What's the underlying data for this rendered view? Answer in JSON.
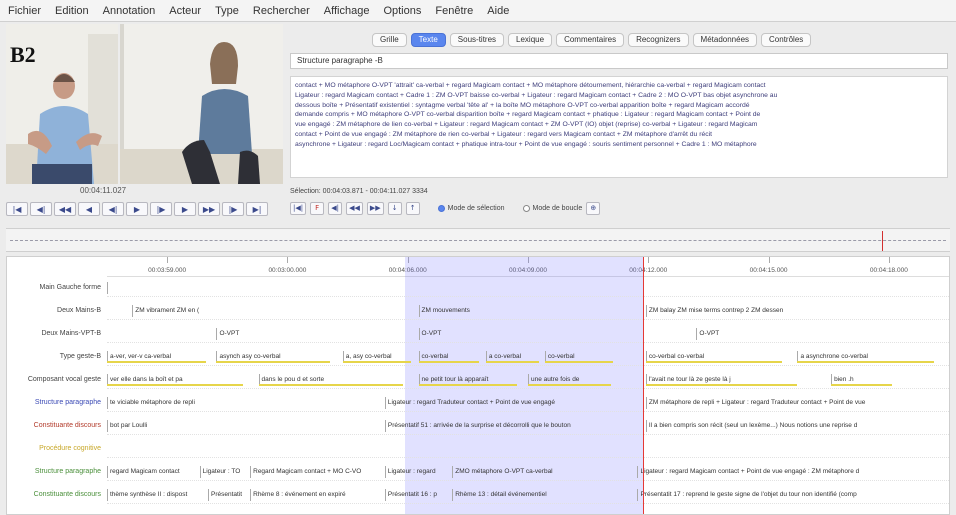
{
  "menu": [
    "Fichier",
    "Edition",
    "Annotation",
    "Acteur",
    "Type",
    "Rechercher",
    "Affichage",
    "Options",
    "Fenêtre",
    "Aide"
  ],
  "video": {
    "watermark": "B2",
    "timecode": "00:04:11.027"
  },
  "media_buttons": [
    "|◀",
    "◀|",
    "◀◀",
    "◀",
    "◀|",
    "▶",
    "|▶",
    "▶",
    "▶▶",
    "|▶",
    "▶|"
  ],
  "tabs": [
    {
      "label": "Grille",
      "active": false
    },
    {
      "label": "Texte",
      "active": true
    },
    {
      "label": "Sous-titres",
      "active": false
    },
    {
      "label": "Lexique",
      "active": false
    },
    {
      "label": "Commentaires",
      "active": false
    },
    {
      "label": "Recognizers",
      "active": false
    },
    {
      "label": "Métadonnées",
      "active": false
    },
    {
      "label": "Contrôles",
      "active": false
    }
  ],
  "tier_selector": "Structure paragraphe -B",
  "text_lines": [
    "contact + MO métaphore O-VPT 'attrait' ca-verbal + regard Magicam contact + MO métaphore détournement, hiérarchie ca-verbal + regard Magicam contact",
    "Ligateur : regard Magicam contact + Cadre 1 : ZM O-VPT baisse co-verbal + Ligateur : regard Magicam contact + Cadre 2 : MO O-VPT bas objet asynchrone au",
    "dessous boîte + Présentatif existentiel : syntagme verbal 'tête al' + la boîte   MO métaphore O-VPT co-verbal apparition boîte + regard Magicam accordé",
    "demande compris + MO métaphore O-VPT co-verbal disparition boîte + regard Magicam contact + phatique : Ligateur : regard Magicam contact + Point de",
    "vue engagé : ZM métaphore de lien co-verbal + Ligateur : regard Magicam contact + ZM O-VPT (IO) objet (reprise) co-verbal + Ligateur : regard Magicam",
    "contact + Point de vue engagé : ZM métaphore de rien co-verbal + Ligateur : regard vers Magicam contact + ZM métaphore d'arrêt du récit",
    "asynchrone + Ligateur : regard Loc/Magicam contact + phatique intra-tour + Point de vue engagé : souris sentiment personnel + Cadre 1 : MO métaphore"
  ],
  "selection": "Sélection: 00:04:03.871 - 00:04:11.027  3334",
  "ctrl_buttons": [
    "|◀|",
    "F",
    "◀|",
    "◀◀",
    "▶▶",
    "↓",
    "↑"
  ],
  "modes": [
    {
      "label": "Mode de sélection",
      "on": true
    },
    {
      "label": "Mode de boucle",
      "on": false
    }
  ],
  "mode_extra": "⊕",
  "ruler_ticks": [
    "00:03:59.000",
    "00:03:00.000",
    "00:04:06.000",
    "00:04:09.000",
    "00:04:12.000",
    "00:04:15.000",
    "00:04:18.000"
  ],
  "tiers": [
    {
      "name": "Main Gauche forme",
      "color": "#444444",
      "annotations": [
        {
          "t": "",
          "s": 0.0,
          "w": 0.04
        }
      ]
    },
    {
      "name": "Deux Mains-B",
      "color": "#444444",
      "annotations": [
        {
          "t": "ZM vibrament  ZM en (",
          "s": 0.03,
          "w": 0.17
        },
        {
          "t": "ZM mouvements",
          "s": 0.37,
          "w": 0.1
        },
        {
          "t": "ZM balay   ZM mise terms contrep 2   ZM dessen",
          "s": 0.64,
          "w": 0.3
        }
      ]
    },
    {
      "name": "Deux Mains-VPT-B",
      "color": "#444444",
      "annotations": [
        {
          "t": "O-VPT",
          "s": 0.13,
          "w": 0.08
        },
        {
          "t": "O-VPT",
          "s": 0.37,
          "w": 0.08
        },
        {
          "t": "O-VPT",
          "s": 0.7,
          "w": 0.08
        }
      ]
    },
    {
      "name": "Type geste-B",
      "color": "#444444",
      "annotations": [
        {
          "t": "a-ver, ver-v  ca-verbal",
          "s": 0.0,
          "w": 0.13
        },
        {
          "t": "asynch  asy  co-verbal",
          "s": 0.13,
          "w": 0.15
        },
        {
          "t": "a, asy  co-verbal",
          "s": 0.28,
          "w": 0.09
        },
        {
          "t": "co-verbal",
          "s": 0.37,
          "w": 0.08
        },
        {
          "t": "a   co-verbal",
          "s": 0.45,
          "w": 0.07
        },
        {
          "t": "co-verbal",
          "s": 0.52,
          "w": 0.09
        },
        {
          "t": "co-verbal  co-verbal",
          "s": 0.64,
          "w": 0.18
        },
        {
          "t": "a   asynchrone  co-verbal",
          "s": 0.82,
          "w": 0.18
        }
      ]
    },
    {
      "name": "Composant vocal geste",
      "color": "#444444",
      "annotations": [
        {
          "t": "ver   elle    dans la boît   et pa",
          "s": 0.0,
          "w": 0.18
        },
        {
          "t": "dans le pou   d    et sorte",
          "s": 0.18,
          "w": 0.19
        },
        {
          "t": "ne petit tour là    apparaît",
          "s": 0.37,
          "w": 0.13
        },
        {
          "t": "une autre fois de",
          "s": 0.5,
          "w": 0.11
        },
        {
          "t": "l'avait    ne tour là   ze geste là   j",
          "s": 0.64,
          "w": 0.2
        },
        {
          "t": "bien .h",
          "s": 0.86,
          "w": 0.08
        }
      ]
    },
    {
      "name": "Structure paragraphe",
      "color": "#3b4ab5",
      "annotations": [
        {
          "t": "te viciable métaphore de repli",
          "s": 0.0,
          "w": 0.33
        },
        {
          "t": "Ligateur : regard Traduteur contact + Point de vue engagé",
          "s": 0.33,
          "w": 0.29
        },
        {
          "t": "ZM métaphore de repli + Ligateur : regard Traduteur contact + Point de vue",
          "s": 0.64,
          "w": 0.36
        }
      ]
    },
    {
      "name": "Constituante discours",
      "color": "#b23a2a",
      "annotations": [
        {
          "t": "bot par Loulli",
          "s": 0.0,
          "w": 0.33
        },
        {
          "t": "Présentatif 51 : arrivée de la surprise et décorrolli que le bouton",
          "s": 0.33,
          "w": 0.31
        },
        {
          "t": "Il a bien compris son récit (seul un lexème...) Nous notions une reprise d",
          "s": 0.64,
          "w": 0.36
        }
      ]
    },
    {
      "name": "Procédure cognitive",
      "color": "#c8a82a",
      "annotations": []
    },
    {
      "name": "Structure paragraphe",
      "color": "#4a8f3a",
      "annotations": [
        {
          "t": "regard Magicam contact",
          "s": 0.0,
          "w": 0.11
        },
        {
          "t": "Ligateur : TO",
          "s": 0.11,
          "w": 0.06
        },
        {
          "t": "Regard Magicam contact + MO C-VO",
          "s": 0.17,
          "w": 0.16
        },
        {
          "t": "Ligateur : regard",
          "s": 0.33,
          "w": 0.08
        },
        {
          "t": "ZMO métaphore O-VPT ca-verbal",
          "s": 0.41,
          "w": 0.22
        },
        {
          "t": "Ligateur : regard Magicam contact + Point de vue engagé : ZM métaphore d",
          "s": 0.63,
          "w": 0.37
        }
      ]
    },
    {
      "name": "Constituante discours",
      "color": "#4a8f3a",
      "annotations": [
        {
          "t": "thème synthèse II : dispost",
          "s": 0.0,
          "w": 0.12
        },
        {
          "t": "Présentatit",
          "s": 0.12,
          "w": 0.05
        },
        {
          "t": "Rhème 8 : événement en expiré",
          "s": 0.17,
          "w": 0.16
        },
        {
          "t": "Présentatit 16 : p",
          "s": 0.33,
          "w": 0.08
        },
        {
          "t": "Rhème 13 : détail événementiel",
          "s": 0.41,
          "w": 0.22
        },
        {
          "t": "Présentatit 17 : reprend le geste signe de l'objet du tour non identifié (comp",
          "s": 0.63,
          "w": 0.37
        }
      ]
    }
  ],
  "selection_band": {
    "start": 0.353,
    "end": 0.635
  },
  "playhead_frac": 0.635,
  "wave_cursor_frac": 0.928
}
